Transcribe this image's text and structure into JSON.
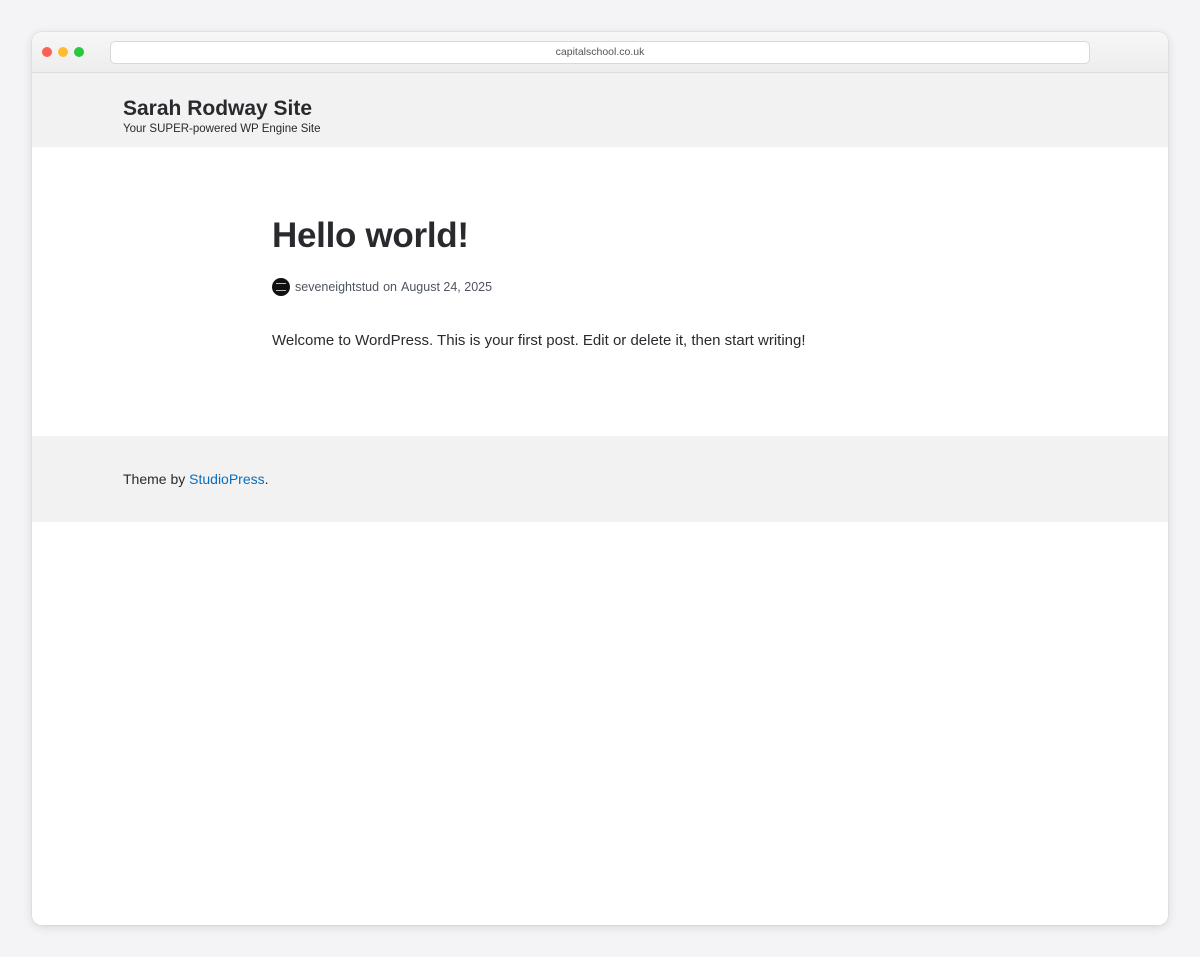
{
  "browser": {
    "url": "capitalschool.co.uk"
  },
  "header": {
    "site_title": "Sarah Rodway Site",
    "site_description": "Your SUPER-powered WP Engine Site"
  },
  "post": {
    "title": "Hello world!",
    "author": "seveneightstud",
    "meta_separator": "on",
    "date": "August 24, 2025",
    "body": "Welcome to WordPress. This is your first post. Edit or delete it, then start writing!"
  },
  "footer": {
    "prefix": "Theme by ",
    "link_text": "StudioPress",
    "suffix": "."
  },
  "colors": {
    "link": "#0a6ebd",
    "header_bg": "#f2f2f2",
    "text": "#282a2e"
  }
}
